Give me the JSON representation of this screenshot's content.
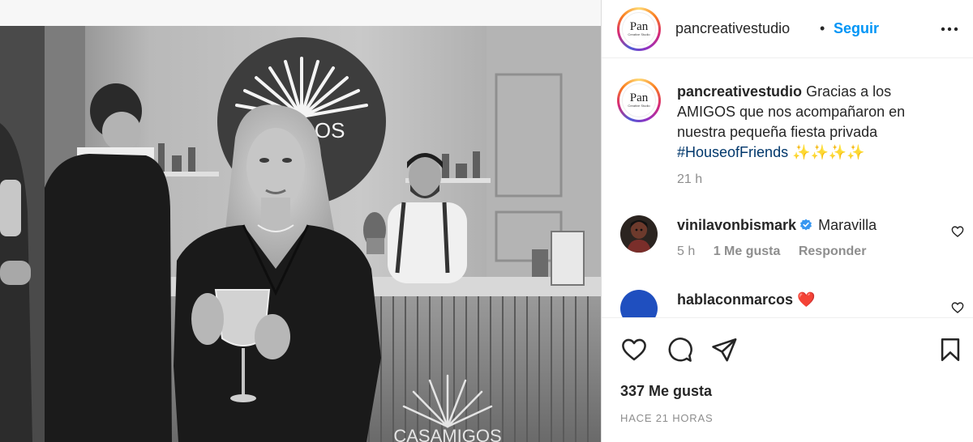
{
  "header": {
    "username": "pancreativestudio",
    "separator": "•",
    "follow_label": "Seguir",
    "avatar": {
      "logo_text": "Pan",
      "logo_subtext": "Creative Studio"
    }
  },
  "photo": {
    "sign_text": "CASAMIGOS",
    "sign_text_cropped": "CA   IGOS",
    "bar_text_cropped": "CASAMIGOS",
    "style": "black-and-white"
  },
  "caption": {
    "username": "pancreativestudio",
    "text": "Gracias a los AMIGOS que nos acompañaron en nuestra pequeña fiesta privada",
    "hashtag": "#HouseofFriends",
    "emoji": "✨✨✨✨",
    "time": "21 h"
  },
  "comments": [
    {
      "username": "vinilavonbismark",
      "verified": true,
      "text": "Maravilla",
      "time": "5 h",
      "likes": "1 Me gusta",
      "reply_label": "Responder",
      "icons": {
        "like": "heart-icon",
        "verified": "verified-badge-icon"
      }
    },
    {
      "username": "hablaconmarcos",
      "text": "❤️",
      "icons": {
        "like": "heart-icon"
      }
    }
  ],
  "actions": {
    "icons": [
      "heart-icon",
      "comment-icon",
      "share-icon",
      "bookmark-icon"
    ],
    "likes_label": "337 Me gusta",
    "timestamp": "HACE 21 HORAS"
  },
  "colors": {
    "follow": "#0095f6",
    "hashtag": "#00376b",
    "muted": "#8e8e8e",
    "verified": "#3897f0",
    "text": "#262626"
  }
}
